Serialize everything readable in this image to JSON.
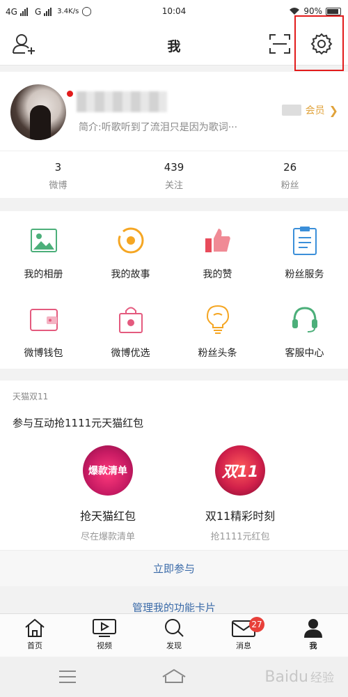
{
  "status": {
    "net1": "4G",
    "net2": "G",
    "speed": "3.4K/s",
    "time": "10:04",
    "battery": "90%"
  },
  "header": {
    "title": "我"
  },
  "profile": {
    "bio": "简介:听歌听到了流泪只是因为歌词···",
    "vip_label": "会员"
  },
  "stats": [
    {
      "value": "3",
      "label": "微博"
    },
    {
      "value": "439",
      "label": "关注"
    },
    {
      "value": "26",
      "label": "粉丝"
    }
  ],
  "grid": [
    {
      "label": "我的相册",
      "icon": "photo-album-icon",
      "color": "#4caf7a"
    },
    {
      "label": "我的故事",
      "icon": "story-icon",
      "color": "#f5a623"
    },
    {
      "label": "我的赞",
      "icon": "thumbs-up-icon",
      "color": "#e84b5b"
    },
    {
      "label": "粉丝服务",
      "icon": "clipboard-icon",
      "color": "#3b8fd9"
    },
    {
      "label": "微博钱包",
      "icon": "wallet-icon",
      "color": "#e45a7e"
    },
    {
      "label": "微博优选",
      "icon": "shopping-bag-icon",
      "color": "#e45a7e"
    },
    {
      "label": "粉丝头条",
      "icon": "lightbulb-icon",
      "color": "#f5a623"
    },
    {
      "label": "客服中心",
      "icon": "headset-icon",
      "color": "#4caf7a"
    }
  ],
  "promo": {
    "tag": "天猫双11",
    "title": "参与互动抢1111元天猫红包",
    "cards": [
      {
        "circle_text": "爆款清单",
        "name": "抢天猫红包",
        "sub": "尽在爆款清单"
      },
      {
        "circle_text": "双11",
        "name": "双11精彩时刻",
        "sub": "抢1111元红包"
      }
    ],
    "join_label": "立即参与",
    "manage_label": "管理我的功能卡片"
  },
  "tabbar": [
    {
      "label": "首页",
      "icon": "home-icon"
    },
    {
      "label": "视频",
      "icon": "video-icon"
    },
    {
      "label": "发现",
      "icon": "search-icon"
    },
    {
      "label": "消息",
      "icon": "message-icon",
      "badge": "27"
    },
    {
      "label": "我",
      "icon": "profile-icon"
    }
  ],
  "watermark": {
    "brand": "Baidu",
    "suffix": "经验"
  },
  "colors": {
    "accent": "#e21b1b",
    "link": "#3a6aa8",
    "vip": "#e0a23a"
  }
}
